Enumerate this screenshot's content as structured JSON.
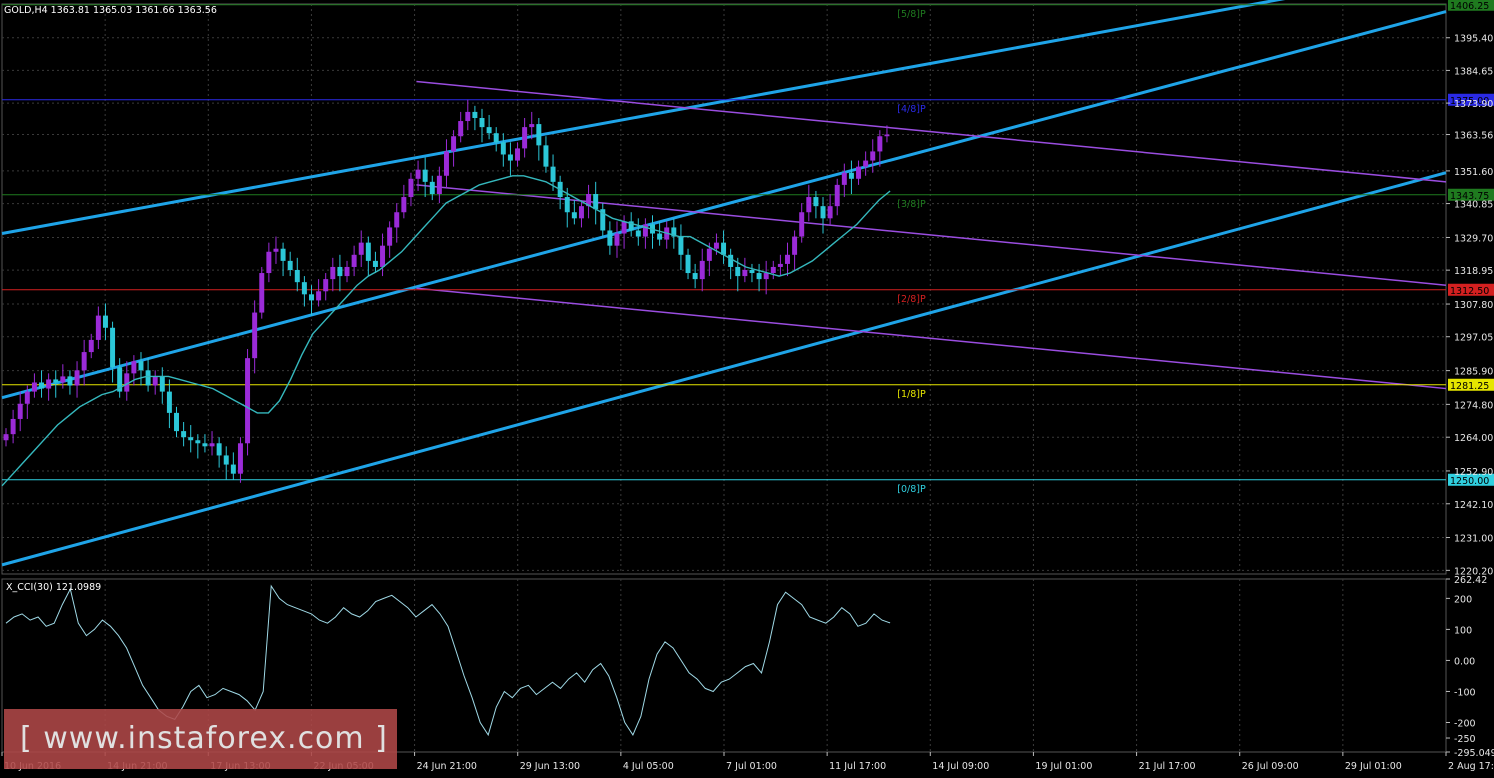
{
  "header": {
    "title": "GOLD,H4  1363.81 1365.03 1361.66 1363.56",
    "indicator": "X_CCI(30) 121.0989"
  },
  "watermark": "[ www.instaforex.com ]",
  "colors": {
    "background": "#000000",
    "grid": "#3a3a3a",
    "bull": "#9b2bd8",
    "bear": "#2cc7d8",
    "ma": "#35b8bd",
    "channel": "#1fa4e8",
    "regression": "#9a4de0",
    "cci": "#9fd9e6"
  },
  "chart_data": [
    {
      "type": "candlestick",
      "symbol": "GOLD",
      "timeframe": "H4",
      "x_labels": [
        "10 Jun 2016",
        "14 Jun 21:00",
        "17 Jun 13:00",
        "22 Jun 05:00",
        "24 Jun 21:00",
        "29 Jun 13:00",
        "4 Jul 05:00",
        "7 Jul 01:00",
        "11 Jul 17:00",
        "14 Jul 09:00",
        "19 Jul 01:00",
        "21 Jul 17:00",
        "26 Jul 09:00",
        "29 Jul 01:00",
        "2 Aug 17:00"
      ],
      "y_ticks": [
        "1395.40",
        "1384.65",
        "1373.90",
        "1363.56",
        "1351.60",
        "1340.85",
        "1329.70",
        "1318.95",
        "1307.80",
        "1297.05",
        "1285.90",
        "1274.80",
        "1264.00",
        "1252.90",
        "1242.10",
        "1231.00",
        "1220.20"
      ],
      "ylim": [
        1219,
        1406.5
      ],
      "last_price": "1363.56",
      "close_series": [
        1265,
        1270,
        1275,
        1279,
        1282,
        1280,
        1283,
        1282,
        1284,
        1281,
        1286,
        1292,
        1296,
        1304,
        1300,
        1287,
        1279,
        1285,
        1289,
        1286,
        1281,
        1284,
        1279,
        1272,
        1266,
        1264,
        1263,
        1262,
        1261,
        1262,
        1258,
        1255,
        1252,
        1262,
        1290,
        1305,
        1318,
        1325,
        1326,
        1322,
        1319,
        1315,
        1311,
        1309,
        1312,
        1316,
        1320,
        1317,
        1320,
        1324,
        1328,
        1322,
        1320,
        1327,
        1333,
        1338,
        1343,
        1349,
        1352,
        1348,
        1344,
        1350,
        1358,
        1363,
        1368,
        1371,
        1369,
        1366,
        1364,
        1361,
        1357,
        1355,
        1359,
        1366,
        1367,
        1360,
        1353,
        1348,
        1343,
        1338,
        1336,
        1340,
        1344,
        1339,
        1332,
        1327,
        1331,
        1335,
        1332,
        1330,
        1334,
        1331,
        1329,
        1333,
        1330,
        1324,
        1318,
        1316,
        1322,
        1326,
        1328,
        1324,
        1320,
        1317,
        1319,
        1318,
        1316,
        1318,
        1320,
        1321,
        1324,
        1330,
        1338,
        1343,
        1340,
        1336,
        1340,
        1347,
        1351,
        1349,
        1353,
        1355,
        1358,
        1363,
        1363.56
      ],
      "ma_series": [
        1248,
        1252,
        1256,
        1260,
        1264,
        1268,
        1271,
        1274,
        1276,
        1278,
        1279,
        1281,
        1283,
        1284,
        1284,
        1284,
        1283,
        1282,
        1281,
        1280,
        1278,
        1276,
        1274,
        1272,
        1272,
        1276,
        1283,
        1291,
        1298,
        1302,
        1306,
        1310,
        1314,
        1317,
        1319,
        1322,
        1325,
        1329,
        1333,
        1337,
        1341,
        1343,
        1345,
        1347,
        1348,
        1349,
        1350,
        1350,
        1349,
        1348,
        1346,
        1344,
        1342,
        1340,
        1338,
        1336,
        1335,
        1334,
        1333,
        1332,
        1331,
        1330,
        1330,
        1328,
        1326,
        1324,
        1322,
        1320,
        1319,
        1318,
        1317,
        1318,
        1320,
        1322,
        1325,
        1328,
        1331,
        1334,
        1338,
        1342,
        1345
      ],
      "levels": [
        {
          "value": "1406.25",
          "label": "[5/8]P",
          "color": "#1f7a1f"
        },
        {
          "value": "1375.00",
          "label": "[4/8]P",
          "color": "#2a2ae6"
        },
        {
          "value": "1343.75",
          "label": "[3/8]P",
          "color": "#1f7a1f"
        },
        {
          "value": "1312.50",
          "label": "[2/8]P",
          "color": "#d42020"
        },
        {
          "value": "1281.25",
          "label": "[1/8]P",
          "color": "#e6e600"
        },
        {
          "value": "1250.00",
          "label": "[0/8]P",
          "color": "#30d0e0"
        }
      ],
      "channel_lines": [
        {
          "from": [
            0,
            1331
          ],
          "to": [
            1,
            1418
          ]
        },
        {
          "from": [
            0,
            1277
          ],
          "to": [
            1,
            1404
          ]
        },
        {
          "from": [
            0,
            1222
          ],
          "to": [
            1,
            1351
          ]
        }
      ],
      "regression_lines": [
        {
          "from": [
            0.287,
            1381
          ],
          "to": [
            1,
            1348
          ]
        },
        {
          "from": [
            0.287,
            1347
          ],
          "to": [
            1,
            1314
          ]
        },
        {
          "from": [
            0.287,
            1313
          ],
          "to": [
            1,
            1280
          ]
        }
      ]
    },
    {
      "type": "line",
      "name": "X_CCI(30)",
      "value": "121.0989",
      "y_ticks": [
        "262.42",
        "200",
        "100",
        "0.00",
        "-100",
        "-200",
        "-250",
        "-295.049"
      ],
      "ylim": [
        -295.049,
        262.42
      ],
      "values": [
        120,
        140,
        150,
        130,
        140,
        110,
        120,
        180,
        230,
        120,
        80,
        100,
        130,
        110,
        80,
        40,
        -20,
        -80,
        -120,
        -160,
        -180,
        -190,
        -150,
        -100,
        -80,
        -120,
        -110,
        -90,
        -100,
        -110,
        -130,
        -160,
        -100,
        240,
        200,
        180,
        170,
        160,
        150,
        130,
        120,
        140,
        170,
        150,
        140,
        160,
        190,
        200,
        210,
        190,
        170,
        140,
        160,
        180,
        150,
        110,
        30,
        -50,
        -120,
        -200,
        -240,
        -150,
        -100,
        -120,
        -90,
        -80,
        -110,
        -90,
        -70,
        -90,
        -60,
        -40,
        -70,
        -30,
        -10,
        -50,
        -120,
        -200,
        -240,
        -180,
        -60,
        20,
        60,
        40,
        0,
        -40,
        -60,
        -90,
        -100,
        -70,
        -60,
        -40,
        -20,
        -10,
        -40,
        60,
        180,
        220,
        200,
        180,
        140,
        130,
        120,
        140,
        170,
        150,
        110,
        120,
        150,
        130,
        121
      ]
    }
  ]
}
